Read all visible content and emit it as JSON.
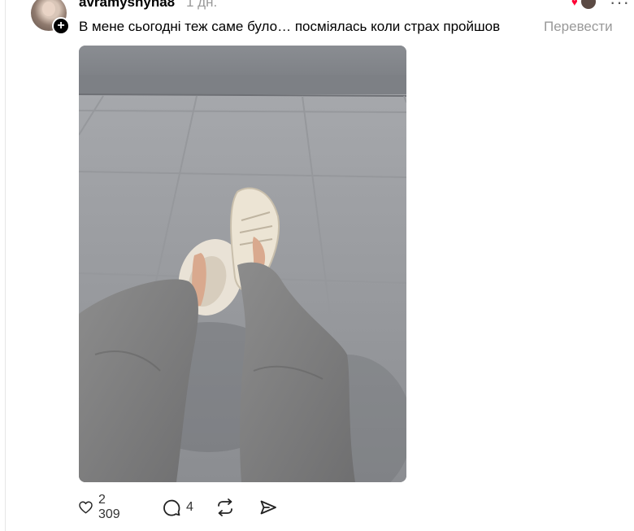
{
  "post": {
    "username": "avramyshyna8",
    "time": "1 дн.",
    "text": "В мене сьогодні теж саме було… посміялась коли страх пройшов",
    "translate_label": "Перевести",
    "more_label": "···"
  },
  "actions": {
    "likes": "2 309",
    "comments": "4"
  },
  "icons": {
    "like": "heart-icon",
    "comment": "comment-icon",
    "repost": "repost-icon",
    "share": "share-icon",
    "follow": "plus-icon"
  },
  "colors": {
    "muted_text": "#999999",
    "like_accent": "#ff0034"
  }
}
